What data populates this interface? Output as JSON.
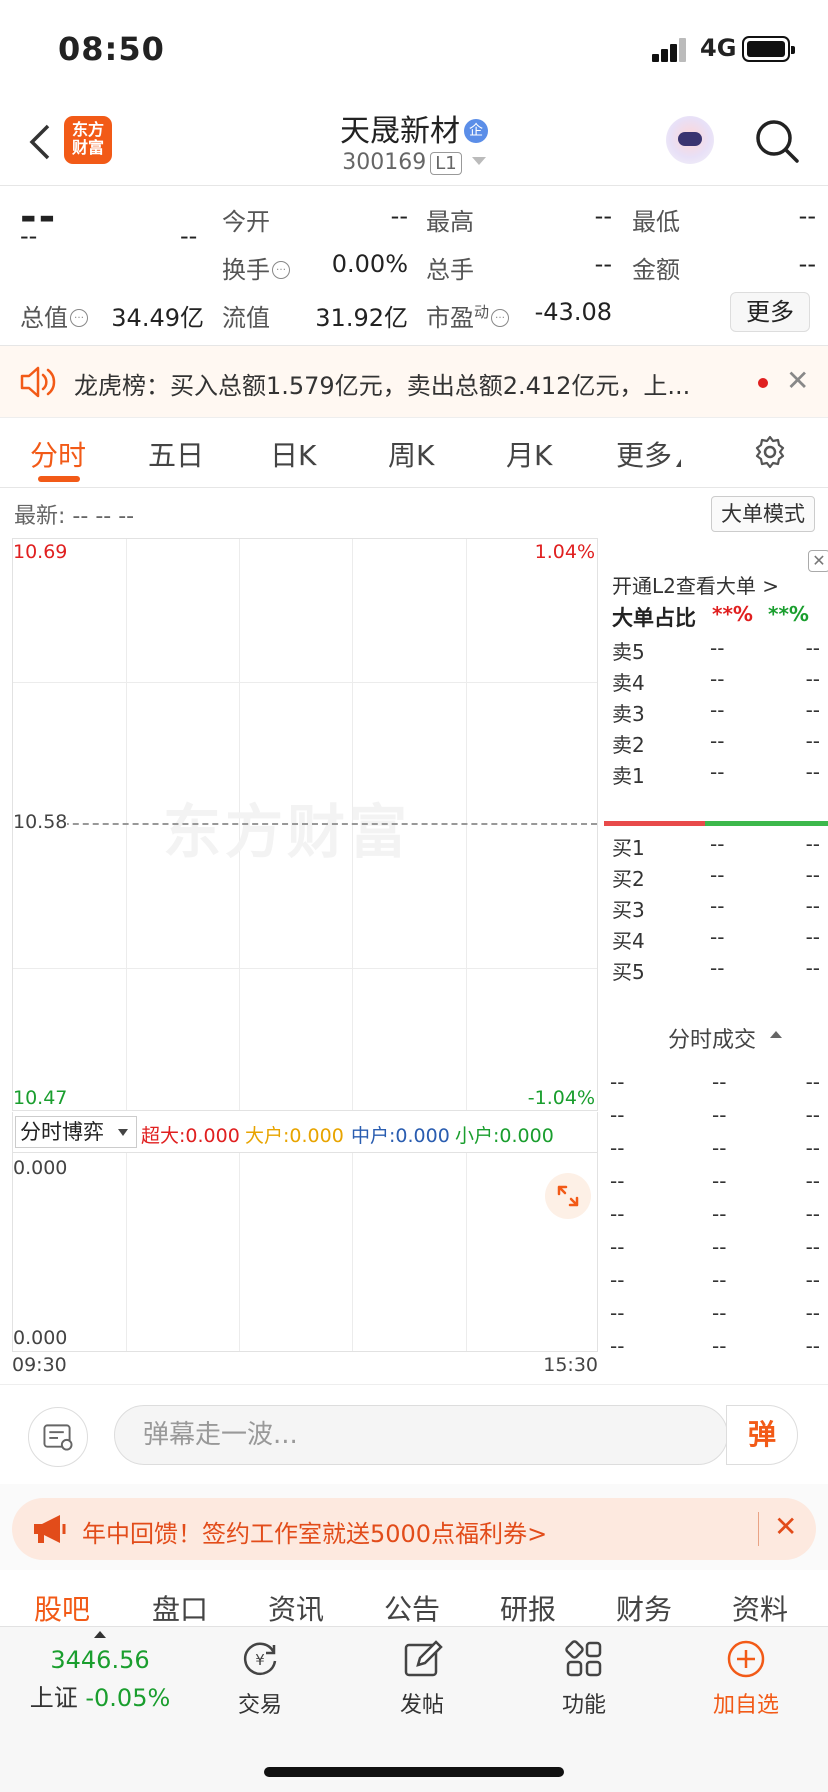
{
  "status_bar": {
    "time": "08:50",
    "network": "4G"
  },
  "header": {
    "logo_text_line1": "东方",
    "logo_text_line2": "财富",
    "stock_name": "天晟新材",
    "company_badge": "企",
    "stock_code": "300169",
    "level": "L1"
  },
  "quote": {
    "price": "--",
    "change": "--",
    "change_pct": "--",
    "open_label": "今开",
    "open": "--",
    "high_label": "最高",
    "high": "--",
    "low_label": "最低",
    "low": "--",
    "turnover_label": "换手",
    "turnover": "0.00%",
    "volume_label": "总手",
    "volume": "--",
    "amount_label": "金额",
    "amount": "--",
    "mktcap_label": "总值",
    "mktcap": "34.49亿",
    "float_label": "流值",
    "float": "31.92亿",
    "pe_label": "市盈",
    "pe_sup": "动",
    "pe": "-43.08",
    "more_button": "更多"
  },
  "notice": {
    "text": "龙虎榜：买入总额1.579亿元，卖出总额2.412亿元，上..."
  },
  "chart_tabs": [
    "分时",
    "五日",
    "日K",
    "周K",
    "月K",
    "更多"
  ],
  "active_tab": "分时",
  "latest": {
    "label": "最新:",
    "v1": "--",
    "v2": "--",
    "v3": "--",
    "big_order_mode": "大单模式"
  },
  "chart": {
    "y_top": "10.69",
    "y_mid": "10.58",
    "y_bottom": "10.47",
    "pct_top": "1.04%",
    "pct_bottom": "-1.04%",
    "watermark": "东方财富",
    "time_start": "09:30",
    "time_end": "15:30"
  },
  "indicator": {
    "selector": "分时博弈",
    "super_large": "超大:0.000",
    "large": "大户:0.000",
    "medium": "中户:0.000",
    "small": "小户:0.000",
    "top_value": "0.000",
    "bottom_value": "0.000"
  },
  "order_book": {
    "l2_link": "开通L2查看大单 >",
    "ratio_label": "大单占比",
    "ratio_buy": "**%",
    "ratio_sell": "**%",
    "asks": [
      {
        "label": "卖5",
        "price": "--",
        "vol": "--"
      },
      {
        "label": "卖4",
        "price": "--",
        "vol": "--"
      },
      {
        "label": "卖3",
        "price": "--",
        "vol": "--"
      },
      {
        "label": "卖2",
        "price": "--",
        "vol": "--"
      },
      {
        "label": "卖1",
        "price": "--",
        "vol": "--"
      }
    ],
    "bids": [
      {
        "label": "买1",
        "price": "--",
        "vol": "--"
      },
      {
        "label": "买2",
        "price": "--",
        "vol": "--"
      },
      {
        "label": "买3",
        "price": "--",
        "vol": "--"
      },
      {
        "label": "买4",
        "price": "--",
        "vol": "--"
      },
      {
        "label": "买5",
        "price": "--",
        "vol": "--"
      }
    ],
    "trades_title": "分时成交",
    "trades": [
      [
        "--",
        "--",
        "--"
      ],
      [
        "--",
        "--",
        "--"
      ],
      [
        "--",
        "--",
        "--"
      ],
      [
        "--",
        "--",
        "--"
      ],
      [
        "--",
        "--",
        "--"
      ],
      [
        "--",
        "--",
        "--"
      ],
      [
        "--",
        "--",
        "--"
      ],
      [
        "--",
        "--",
        "--"
      ],
      [
        "--",
        "--",
        "--"
      ]
    ]
  },
  "danmu": {
    "placeholder": "弹幕走一波...",
    "button": "弹"
  },
  "promo": {
    "text": "年中回馈！签约工作室就送5000点福利券>"
  },
  "content_tabs": [
    "股吧",
    "盘口",
    "资讯",
    "公告",
    "研报",
    "财务",
    "资料"
  ],
  "bottom_nav": {
    "index_value": "3446.56",
    "index_name": "上证",
    "index_change": "-0.05%",
    "items": [
      "交易",
      "发帖",
      "功能",
      "加自选"
    ]
  },
  "colors": {
    "accent": "#f25a17",
    "up": "#e02020",
    "down": "#1a9e2e"
  }
}
